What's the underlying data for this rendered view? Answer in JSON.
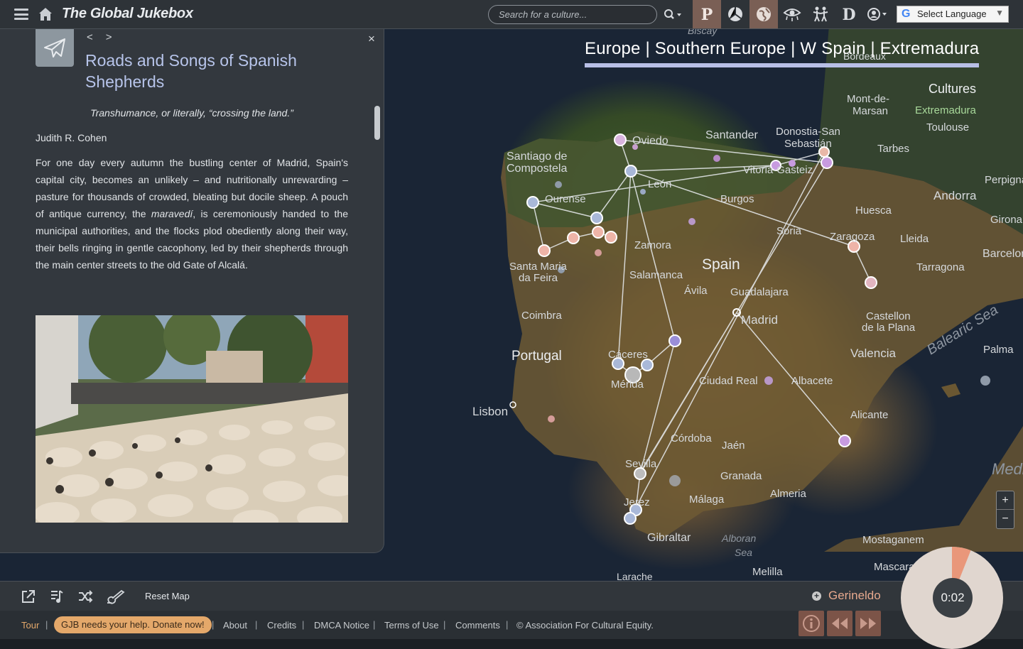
{
  "header": {
    "brand": "The Global Jukebox",
    "search_placeholder": "Search for a culture...",
    "language_label": "Select Language",
    "icons": [
      "menu-icon",
      "home-icon",
      "search-icon",
      "p-icon",
      "canteros-icon",
      "globe-icon",
      "eye-icon",
      "dance-icon",
      "d-icon",
      "profile-icon"
    ]
  },
  "map": {
    "breadcrumb": "Europe | Southern Europe | W Spain | Extremadura",
    "cultures_title": "Cultures",
    "selected_culture": "Extremadura",
    "labels": [
      "Biscay",
      "Bordeaux",
      "Mont-de-Marsan",
      "Toulouse",
      "Tarbes",
      "Perpignan",
      "Andorra",
      "Girona",
      "Barcelona",
      "Oviedo",
      "Santander",
      "Donostia-San Sebastián",
      "Santiago de Compostela",
      "León",
      "Vitoria-Gasteiz",
      "Burgos",
      "Ourense",
      "Huesca",
      "Lleida",
      "Zaragoza",
      "Soria",
      "Zamora",
      "Tarragona",
      "Santa Maria da Feira",
      "Salamanca",
      "Spain",
      "Ávila",
      "Guadalajara",
      "Coimbra",
      "Madrid",
      "Castellon de la Plana",
      "Portugal",
      "Cáceres",
      "Valencia",
      "Mérida",
      "Ciudad Real",
      "Albacete",
      "Palma",
      "Lisbon",
      "Alicante",
      "Córdoba",
      "Jaén",
      "Sevilla",
      "Granada",
      "Almeria",
      "Málaga",
      "Jerez",
      "Gibraltar",
      "Alboran Sea",
      "Mostaganem",
      "Melilla",
      "Mascara",
      "Larache",
      "Balearic Sea",
      "Medi"
    ],
    "zoom_in": "+",
    "zoom_out": "−"
  },
  "panel": {
    "prev": "<",
    "next": ">",
    "close": "×",
    "title": "Roads and Songs of Spanish Shepherds",
    "quote": "Transhumance, or literally, “crossing the land.”",
    "author": "Judith R. Cohen",
    "body_before": "For one day every autumn the bustling center of Madrid, Spain's capital city, becomes an unlikely – and nutritionally unrewarding – pasture for thousands of crowded, bleating but docile sheep. A pouch of antique currency, the ",
    "body_em": "maravedí",
    "body_after": ", is ceremoniously handed to the municipal authorities, and the flocks plod obediently along their way, their bells ringing in gentle cacophony, led by their shepherds through the main center streets to the old Gate of Alcalá."
  },
  "player": {
    "reset_map": "Reset Map",
    "song": "Gerineldo",
    "time": "0:02",
    "progress_fraction": 0.06
  },
  "footer": {
    "tour": "Tour",
    "donate": "GJB needs your help. Donate now!",
    "about": "About",
    "credits": "Credits",
    "dmca": "DMCA Notice",
    "terms": "Terms of Use",
    "comments": "Comments",
    "copyright": "© Association For Cultural Equity."
  }
}
